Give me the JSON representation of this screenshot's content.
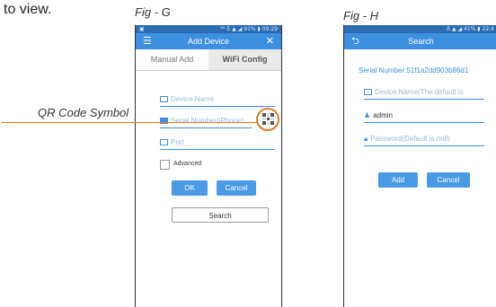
{
  "intro_text": "to view.",
  "callout": {
    "label": "QR Code Symbol"
  },
  "fig_g": {
    "label": "Fig - G",
    "status": {
      "left": "▣",
      "right": "⁴⁶ ♁ ▲ ◢ 91% ▮ 09:29"
    },
    "appbar": {
      "title": "Add Device",
      "menu_icon": "☰",
      "close_icon": "✕"
    },
    "tabs": [
      {
        "label": "Manual Add"
      },
      {
        "label": "WiFi Config"
      }
    ],
    "fields": {
      "device_name": {
        "placeholder": "Device Name"
      },
      "serial_number": {
        "placeholder": "Serial Number(iPhone)"
      },
      "port": {
        "placeholder": "Port"
      }
    },
    "advanced_label": "Advanced",
    "ok_label": "OK",
    "cancel_label": "Cancel",
    "search_label": "Search"
  },
  "fig_h": {
    "label": "Fig - H",
    "status": {
      "right": "♁ ▲ ◢ 41% ▮ 22:4"
    },
    "appbar": {
      "title": "Search",
      "back_icon": "⮌"
    },
    "serial_text": "Serial Number:51f1a2dd903b86d1",
    "fields": {
      "device_name": {
        "placeholder": "Device Name(The default is"
      },
      "username": {
        "value": "admin"
      },
      "password": {
        "placeholder": "Password(Default is null)"
      }
    },
    "add_label": "Add",
    "cancel_label": "Cancel"
  },
  "colors": {
    "accent": "#3d8fe0",
    "statusbar": "#2b6bb3",
    "callout": "#e07a28"
  }
}
